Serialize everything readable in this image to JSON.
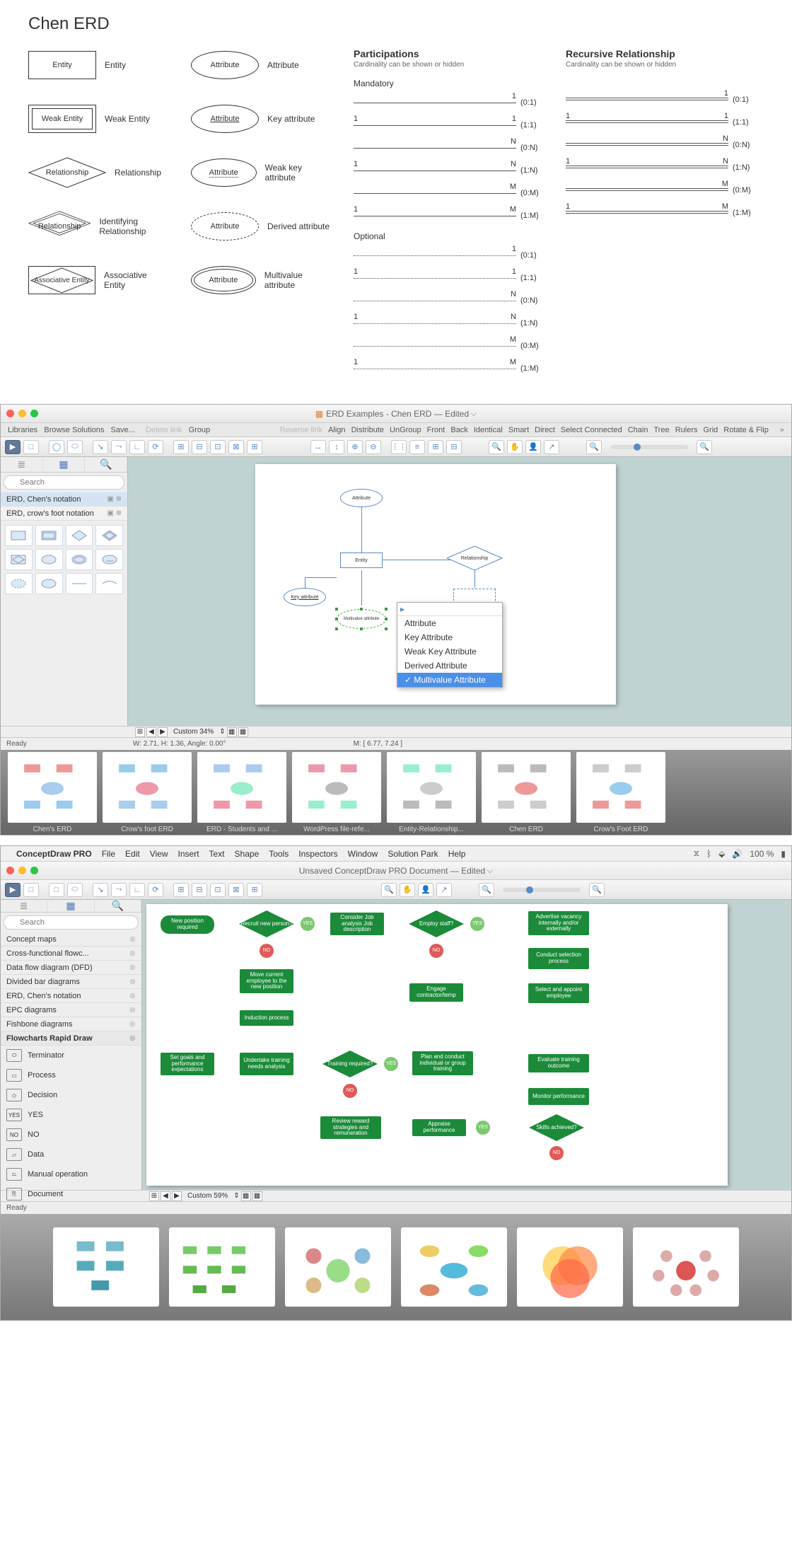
{
  "reference": {
    "title": "Chen ERD",
    "entities": [
      {
        "shape": "rect",
        "label": "Entity",
        "desc": "Entity"
      },
      {
        "shape": "weak",
        "label": "Weak Entity",
        "desc": "Weak Entity"
      },
      {
        "shape": "diamond",
        "label": "Relationship",
        "desc": "Relationship"
      },
      {
        "shape": "double-diamond",
        "label": "Relationship",
        "desc": "Identifying Relationship"
      },
      {
        "shape": "assoc",
        "label": "Associative Entity",
        "desc": "Associative Entity"
      }
    ],
    "attributes": [
      {
        "variant": "",
        "label": "Attribute",
        "desc": "Attribute"
      },
      {
        "variant": "key",
        "label": "Attribute",
        "desc": "Key attribute"
      },
      {
        "variant": "weakkey",
        "label": "Attribute",
        "desc": "Weak key attribute"
      },
      {
        "variant": "derived",
        "label": "Attribute",
        "desc": "Derived attribute"
      },
      {
        "variant": "multi",
        "label": "Attribute",
        "desc": "Multivalue attribute"
      }
    ],
    "participations": {
      "header": "Participations",
      "sub": "Cardinality can be shown or hidden",
      "mandatory_label": "Mandatory",
      "optional_label": "Optional",
      "mandatory": [
        {
          "left": "",
          "right": "1",
          "label": "(0:1)"
        },
        {
          "left": "1",
          "right": "1",
          "label": "(1:1)"
        },
        {
          "left": "",
          "right": "N",
          "label": "(0:N)"
        },
        {
          "left": "1",
          "right": "N",
          "label": "(1:N)"
        },
        {
          "left": "",
          "right": "M",
          "label": "(0:M)"
        },
        {
          "left": "1",
          "right": "M",
          "label": "(1:M)"
        }
      ],
      "optional": [
        {
          "left": "",
          "right": "1",
          "label": "(0:1)"
        },
        {
          "left": "1",
          "right": "1",
          "label": "(1:1)"
        },
        {
          "left": "",
          "right": "N",
          "label": "(0:N)"
        },
        {
          "left": "1",
          "right": "N",
          "label": "(1:N)"
        },
        {
          "left": "",
          "right": "M",
          "label": "(0:M)"
        },
        {
          "left": "1",
          "right": "M",
          "label": "(1:M)"
        }
      ]
    },
    "recursive": {
      "header": "Recursive Relationship",
      "sub": "Cardinality can be shown or hidden",
      "rows": [
        {
          "left": "",
          "right": "1",
          "label": "(0:1)"
        },
        {
          "left": "1",
          "right": "1",
          "label": "(1:1)"
        },
        {
          "left": "",
          "right": "N",
          "label": "(0:N)"
        },
        {
          "left": "1",
          "right": "N",
          "label": "(1:N)"
        },
        {
          "left": "",
          "right": "M",
          "label": "(0:M)"
        },
        {
          "left": "1",
          "right": "M",
          "label": "(1:M)"
        }
      ]
    }
  },
  "app1": {
    "title": "ERD Examples - Chen ERD — Edited",
    "menu_left": [
      "Libraries",
      "Browse Solutions",
      "Save..."
    ],
    "menu_dim": [
      "Delete link"
    ],
    "menu_mid": [
      "Group"
    ],
    "menu_right": [
      "Reverse link",
      "Align",
      "Distribute",
      "UnGroup",
      "Front",
      "Back",
      "Identical",
      "Smart",
      "Direct",
      "Select Connected",
      "Chain",
      "Tree",
      "Rulers",
      "Grid",
      "Rotate & Flip"
    ],
    "search_placeholder": "Search",
    "libs": [
      "ERD, Chen's notation",
      "ERD, crow's foot notation"
    ],
    "zoom_label": "Custom 34%",
    "status_w": "W: 2.71,  H: 1.36,  Angle: 0.00°",
    "status_m": "M: [ 6.77, 7.24 ]",
    "status_ready": "Ready",
    "canvas": {
      "attribute": "Attribute",
      "entity": "Entity",
      "relationship": "Relationship",
      "key_attribute": "Key attribute",
      "multivalue": "Multivalue attribute"
    },
    "context_menu": [
      "Attribute",
      "Key Attribute",
      "Weak Key Attribute",
      "Derived Attribute",
      "Multivalue Attribute"
    ],
    "context_selected": 4,
    "thumbs": [
      "Chen's ERD",
      "Crow's foot ERD",
      "ERD - Students and ...",
      "WordPress file-refe...",
      "Entity-Relationship...",
      "Chen ERD",
      "Crow's Foot ERD"
    ]
  },
  "app2": {
    "mac_menu": [
      "ConceptDraw PRO",
      "File",
      "Edit",
      "View",
      "Insert",
      "Text",
      "Shape",
      "Tools",
      "Inspectors",
      "Window",
      "Solution Park",
      "Help"
    ],
    "battery": "100 %",
    "title": "Unsaved ConceptDraw PRO Document — Edited",
    "search_placeholder": "Search",
    "libs": [
      "Concept maps",
      "Cross-functional flowc...",
      "Data flow diagram (DFD)",
      "Divided bar diagrams",
      "ERD, Chen's notation",
      "EPC diagrams",
      "Fishbone diagrams",
      "Flowcharts Rapid Draw"
    ],
    "selected_lib": 7,
    "shapes": [
      "Terminator",
      "Process",
      "Decision",
      "YES",
      "NO",
      "Data",
      "Manual operation",
      "Document"
    ],
    "zoom_label": "Custom 59%",
    "status_ready": "Ready",
    "flow_nodes": {
      "new_position": "New position required",
      "recruit": "Recruit new person?",
      "consider": "Consider Job analysis Job description",
      "employ": "Employ staff?",
      "advertise": "Advertise vacancy internally and/or externally",
      "conduct_sel": "Conduct selection process",
      "move_current": "Move current employee to the new position",
      "engage": "Engage contractor/temp",
      "select_appoint": "Select and appoint employee",
      "induction": "Induction process",
      "set_goals": "Set goals and performance expectations",
      "undertake": "Undertake training needs analysis",
      "training_req": "Training required?",
      "plan_conduct": "Plan and conduct individual or group training",
      "evaluate": "Evaluate training outcome",
      "monitor": "Monitor performance",
      "review": "Review reward strategies and remuneration",
      "appraise": "Appraise performance",
      "skills": "Skills achieved?",
      "yes": "YES",
      "no": "NO"
    }
  }
}
